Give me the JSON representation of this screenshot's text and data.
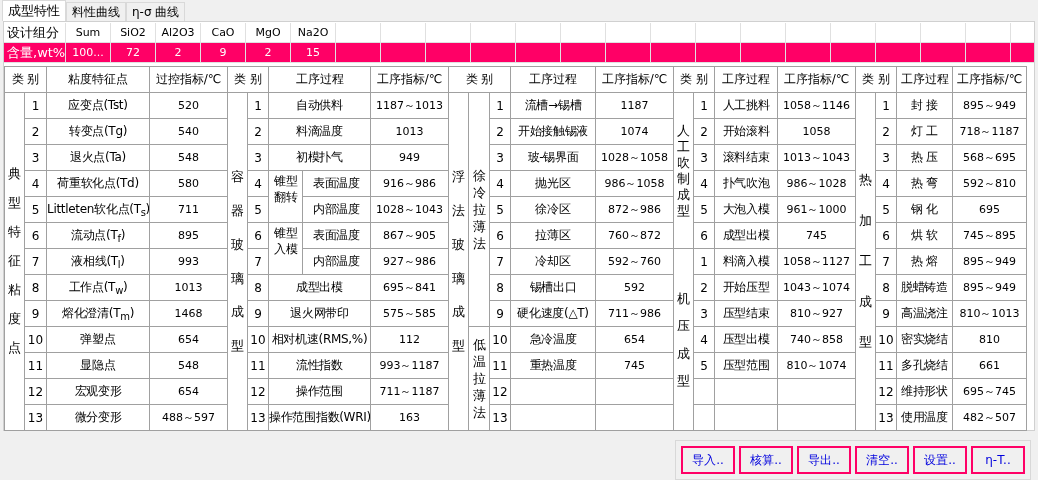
{
  "tabs": [
    {
      "label": "成型特性",
      "selected": true
    },
    {
      "label": "料性曲线",
      "selected": false
    },
    {
      "label": "η-σ 曲线",
      "selected": false
    }
  ],
  "composition": {
    "rows": [
      {
        "label": "设计组分",
        "cells": [
          "Sum",
          "SiO2",
          "Al2O3",
          "CaO",
          "MgO",
          "Na2O"
        ],
        "selected": false
      },
      {
        "label": "含量,wt%",
        "cells": [
          "100...",
          "72",
          "2",
          "9",
          "2",
          "15"
        ],
        "selected": true
      }
    ]
  },
  "sections": [
    {
      "headers": {
        "category": "类 别",
        "process": "粘度特征点",
        "value": "过控指标/℃"
      },
      "groups": [
        {
          "label": "典型特征粘度点",
          "rows": [
            {
              "no": "1",
              "name": "应变点(Tst)",
              "value": "520"
            },
            {
              "no": "2",
              "name": "转变点(Tg)",
              "value": "540"
            },
            {
              "no": "3",
              "name": "退火点(Ta)",
              "value": "548"
            },
            {
              "no": "4",
              "name": "荷重软化点(Td)",
              "value": "580"
            },
            {
              "no": "5",
              "name": "Littleten软化点(T$_{s}$)",
              "value": "711"
            },
            {
              "no": "6",
              "name": "流动点(T$_{f}$)",
              "value": "895"
            },
            {
              "no": "7",
              "name": "液相线(T$_{l}$)",
              "value": "993"
            },
            {
              "no": "8",
              "name": "工作点(T$_{w}$)",
              "value": "1013"
            },
            {
              "no": "9",
              "name": "熔化澄清(T$_{m}$)",
              "value": "1468"
            },
            {
              "no": "10",
              "name": "弹塑点",
              "value": "654"
            },
            {
              "no": "11",
              "name": "显隐点",
              "value": "548"
            },
            {
              "no": "12",
              "name": "宏观变形",
              "value": "654"
            },
            {
              "no": "13",
              "name": "微分变形",
              "value": "488～597"
            }
          ]
        }
      ]
    },
    {
      "headers": {
        "category": "类 别",
        "process": "工序过程",
        "value": "工序指标/℃"
      },
      "groups": [
        {
          "label": "容器玻璃成型",
          "rows": [
            {
              "kind": "step",
              "no": "1",
              "name": "自动供料",
              "value": "1187～1013"
            },
            {
              "kind": "step",
              "no": "2",
              "name": "料滴温度",
              "value": "1013"
            },
            {
              "kind": "step",
              "no": "3",
              "name": "初模扑气",
              "value": "949"
            },
            {
              "kind": "pair",
              "label": "锥型翻转",
              "rows": [
                {
                  "no": "4",
                  "name": "表面温度",
                  "value": "916～986"
                },
                {
                  "no": "5",
                  "name": "内部温度",
                  "value": "1028～1043"
                }
              ]
            },
            {
              "kind": "pair",
              "label": "锥型入模",
              "rows": [
                {
                  "no": "6",
                  "name": "表面温度",
                  "value": "867～905"
                },
                {
                  "no": "7",
                  "name": "内部温度",
                  "value": "927～986"
                }
              ]
            },
            {
              "kind": "step",
              "no": "8",
              "name": "成型出模",
              "value": "695～841"
            },
            {
              "kind": "step",
              "no": "9",
              "name": "退火网带印",
              "value": "575～585"
            },
            {
              "kind": "step",
              "no": "10",
              "name": "相对机速(RMS,%)",
              "value": "112"
            },
            {
              "kind": "step",
              "no": "11",
              "name": "流性指数",
              "value": "993～1187"
            },
            {
              "kind": "step",
              "no": "12",
              "name": "操作范围",
              "value": "711～1187"
            },
            {
              "kind": "step",
              "no": "13",
              "name": "操作范围指数(WRI)",
              "value": "163"
            }
          ]
        }
      ]
    },
    {
      "headers": {
        "category": "类 别",
        "process": "工序过程",
        "value": "工序指标/℃"
      },
      "groups": [
        {
          "label": "浮法玻璃成型",
          "subgroups": [
            {
              "label": "徐冷拉薄法",
              "rows": [
                {
                  "no": "1",
                  "name": "流槽→锡槽",
                  "value": "1187"
                },
                {
                  "no": "2",
                  "name": "开始接触锡液",
                  "value": "1074"
                },
                {
                  "no": "3",
                  "name": "玻-锡界面",
                  "value": "1028～1058"
                },
                {
                  "no": "4",
                  "name": "抛光区",
                  "value": "986～1058"
                },
                {
                  "no": "5",
                  "name": "徐冷区",
                  "value": "872～986"
                },
                {
                  "no": "6",
                  "name": "拉薄区",
                  "value": "760～872"
                },
                {
                  "no": "7",
                  "name": "冷却区",
                  "value": "592～760"
                },
                {
                  "no": "8",
                  "name": "锡槽出口",
                  "value": "592"
                },
                {
                  "no": "9",
                  "name": "硬化速度(△T)",
                  "value": "711～986"
                }
              ]
            },
            {
              "label": "低温拉薄法",
              "rows": [
                {
                  "no": "10",
                  "name": "急冷温度",
                  "value": "654"
                },
                {
                  "no": "11",
                  "name": "重热温度",
                  "value": "745"
                },
                {
                  "no": "12"
                },
                {
                  "no": "13"
                }
              ]
            }
          ]
        }
      ]
    },
    {
      "headers": {
        "category": "类 别",
        "process": "工序过程",
        "value": "工序指标/℃"
      },
      "groups": [
        {
          "label": "人工吹制成型",
          "rows": [
            {
              "no": "1",
              "name": "人工挑料",
              "value": "1058～1146"
            },
            {
              "no": "2",
              "name": "开始滚料",
              "value": "1058"
            },
            {
              "no": "3",
              "name": "滚料结束",
              "value": "1013～1043"
            },
            {
              "no": "4",
              "name": "扑气吹泡",
              "value": "986～1028"
            },
            {
              "no": "5",
              "name": "大泡入模",
              "value": "961～1000"
            },
            {
              "no": "6",
              "name": "成型出模",
              "value": "745"
            }
          ]
        },
        {
          "label": "机压成型",
          "rows": [
            {
              "no": "1",
              "name": "料滴入模",
              "value": "1058～1127"
            },
            {
              "no": "2",
              "name": "开始压型",
              "value": "1043～1074"
            },
            {
              "no": "3",
              "name": "压型结束",
              "value": "810～927"
            },
            {
              "no": "4",
              "name": "压型出模",
              "value": "740～858"
            },
            {
              "no": "5",
              "name": "压型范围",
              "value": "810～1074"
            }
          ]
        }
      ]
    },
    {
      "headers": {
        "category": "类 别",
        "process": "工序过程",
        "value": "工序指标/℃"
      },
      "groups": [
        {
          "label": "热加工成型",
          "rows": [
            {
              "no": "1",
              "name": "封 接",
              "value": "895～949"
            },
            {
              "no": "2",
              "name": "灯 工",
              "value": "718～1187"
            },
            {
              "no": "3",
              "name": "热 压",
              "value": "568～695"
            },
            {
              "no": "4",
              "name": "热 弯",
              "value": "592～810"
            },
            {
              "no": "5",
              "name": "钢 化",
              "value": "695"
            },
            {
              "no": "6",
              "name": "烘 软",
              "value": "745～895"
            },
            {
              "no": "7",
              "name": "热 熔",
              "value": "895～949"
            },
            {
              "no": "8",
              "name": "脱蜡铸造",
              "value": "895～949"
            },
            {
              "no": "9",
              "name": "高温浇注",
              "value": "810～1013"
            },
            {
              "no": "10",
              "name": "密实烧结",
              "value": "810"
            },
            {
              "no": "11",
              "name": "多孔烧结",
              "value": "661"
            },
            {
              "no": "12",
              "name": "维持形状",
              "value": "695～745"
            },
            {
              "no": "13",
              "name": "使用温度",
              "value": "482～507"
            }
          ]
        }
      ]
    }
  ],
  "buttons": [
    "导入..",
    "核算..",
    "导出..",
    "清空..",
    "设置..",
    "η-T.."
  ]
}
